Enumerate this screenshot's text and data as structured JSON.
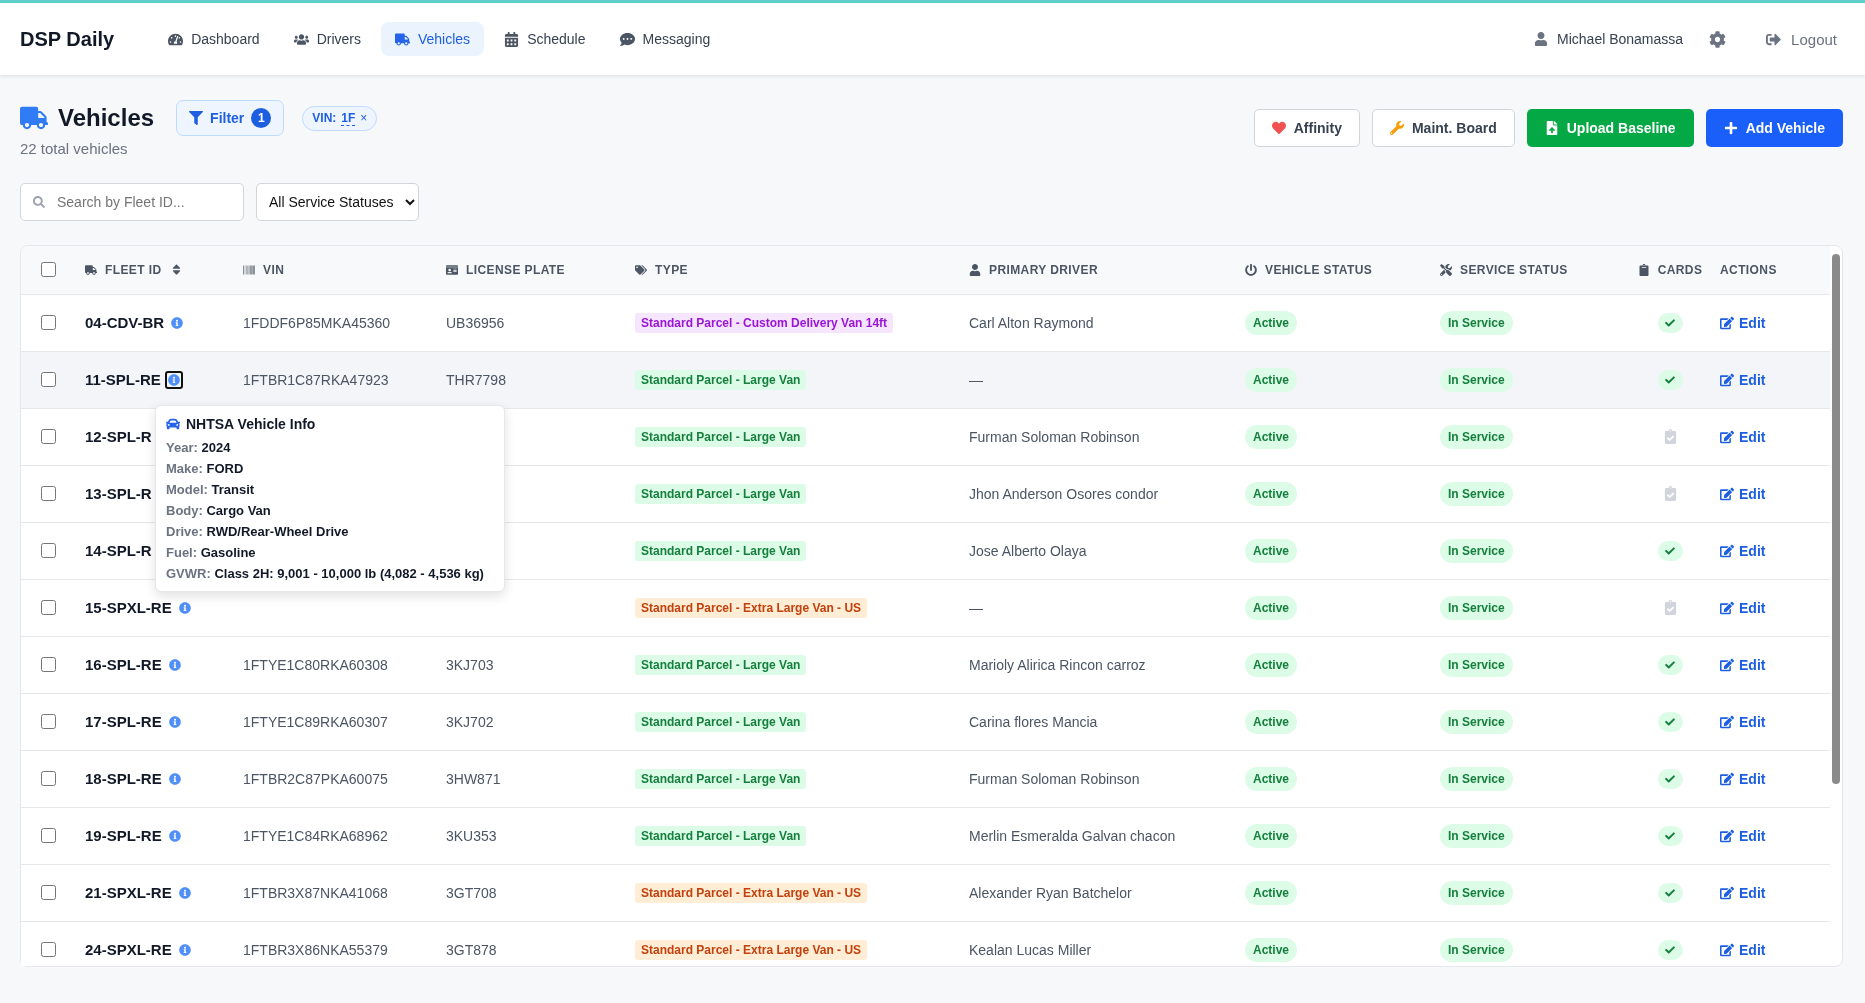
{
  "brand": "DSP Daily",
  "nav": [
    {
      "label": "Dashboard",
      "selected": false
    },
    {
      "label": "Drivers",
      "selected": false
    },
    {
      "label": "Vehicles",
      "selected": true
    },
    {
      "label": "Schedule",
      "selected": false
    },
    {
      "label": "Messaging",
      "selected": false
    }
  ],
  "user": {
    "name": "Michael Bonamassa"
  },
  "logout": "Logout",
  "page": {
    "title": "Vehicles",
    "subtitle": "22 total vehicles"
  },
  "filter_button": {
    "label": "Filter",
    "count": "1"
  },
  "filter_chips": [
    {
      "label": "VIN:",
      "value": "1F",
      "remove": "×"
    }
  ],
  "actions": [
    {
      "label": "Affinity",
      "kind": "outline"
    },
    {
      "label": "Maint. Board",
      "kind": "outline"
    },
    {
      "label": "Upload Baseline",
      "kind": "success"
    },
    {
      "label": "Add Vehicle",
      "kind": "primary"
    }
  ],
  "search": {
    "placeholder": "Search by Fleet ID..."
  },
  "status_select": {
    "value": "All Service Statuses"
  },
  "table": {
    "select_all": {
      "checked": false
    },
    "columns": [
      {
        "label": "FLEET ID",
        "sortable": true
      },
      {
        "label": "VIN",
        "sortable": false
      },
      {
        "label": "LICENSE PLATE",
        "sortable": false
      },
      {
        "label": "TYPE",
        "sortable": false
      },
      {
        "label": "PRIMARY DRIVER",
        "sortable": false
      },
      {
        "label": "VEHICLE STATUS",
        "sortable": false
      },
      {
        "label": "SERVICE STATUS",
        "sortable": false
      },
      {
        "label": "CARDS",
        "sortable": false
      },
      {
        "label": "ACTIONS",
        "sortable": false
      }
    ],
    "rows": [
      {
        "fleet_id": "04-CDV-BR",
        "vin": "1FDDF6P85MKA45360",
        "plate": "UB36956",
        "type": {
          "label": "Standard Parcel - Custom Delivery Van 14ft",
          "kind": "custom"
        },
        "driver": "Carl Alton Raymond",
        "vehicle_status": "Active",
        "service_status": "In Service",
        "cards_complete": true,
        "action": "Edit",
        "checked": false,
        "hovered": false
      },
      {
        "fleet_id": "11-SPL-RE",
        "vin": "1FTBR1C87RKA47923",
        "plate": "THR7798",
        "type": {
          "label": "Standard Parcel - Large Van",
          "kind": "large"
        },
        "driver": "—",
        "vehicle_status": "Active",
        "service_status": "In Service",
        "cards_complete": true,
        "action": "Edit",
        "checked": false,
        "hovered": true,
        "tooltip": {
          "title": "NHTSA Vehicle Info",
          "fields": [
            {
              "label": "Year:",
              "value": "2024"
            },
            {
              "label": "Make:",
              "value": "FORD"
            },
            {
              "label": "Model:",
              "value": "Transit"
            },
            {
              "label": "Body:",
              "value": "Cargo Van"
            },
            {
              "label": "Drive:",
              "value": "RWD/Rear-Wheel Drive"
            },
            {
              "label": "Fuel:",
              "value": "Gasoline"
            },
            {
              "label": "GVWR:",
              "value": "Class 2H: 9,001 - 10,000 lb (4,082 - 4,536 kg)"
            }
          ]
        }
      },
      {
        "fleet_id": "12-SPL-R",
        "type": {
          "label": "Standard Parcel - Large Van",
          "kind": "large"
        },
        "driver": "Furman Soloman Robinson",
        "vehicle_status": "Active",
        "service_status": "In Service",
        "cards_complete": false,
        "action": "Edit",
        "checked": false,
        "hovered": false
      },
      {
        "fleet_id": "13-SPL-R",
        "type": {
          "label": "Standard Parcel - Large Van",
          "kind": "large"
        },
        "driver": "Jhon Anderson Osores condor",
        "vehicle_status": "Active",
        "service_status": "In Service",
        "cards_complete": false,
        "action": "Edit",
        "checked": false,
        "hovered": false
      },
      {
        "fleet_id": "14-SPL-R",
        "type": {
          "label": "Standard Parcel - Large Van",
          "kind": "large"
        },
        "driver": "Jose Alberto Olaya",
        "vehicle_status": "Active",
        "service_status": "In Service",
        "cards_complete": true,
        "action": "Edit",
        "checked": false,
        "hovered": false
      },
      {
        "fleet_id": "15-SPXL-RE",
        "type": {
          "label": "Standard Parcel - Extra Large Van - US",
          "kind": "xl"
        },
        "driver": "—",
        "vehicle_status": "Active",
        "service_status": "In Service",
        "cards_complete": false,
        "action": "Edit",
        "checked": false,
        "hovered": false
      },
      {
        "fleet_id": "16-SPL-RE",
        "vin": "1FTYE1C80RKA60308",
        "plate": "3KJ703",
        "type": {
          "label": "Standard Parcel - Large Van",
          "kind": "large"
        },
        "driver": "Marioly Alirica Rincon carroz",
        "vehicle_status": "Active",
        "service_status": "In Service",
        "cards_complete": true,
        "action": "Edit",
        "checked": false,
        "hovered": false
      },
      {
        "fleet_id": "17-SPL-RE",
        "vin": "1FTYE1C89RKA60307",
        "plate": "3KJ702",
        "type": {
          "label": "Standard Parcel - Large Van",
          "kind": "large"
        },
        "driver": "Carina flores Mancia",
        "vehicle_status": "Active",
        "service_status": "In Service",
        "cards_complete": true,
        "action": "Edit",
        "checked": false,
        "hovered": false
      },
      {
        "fleet_id": "18-SPL-RE",
        "vin": "1FTBR2C87PKA60075",
        "plate": "3HW871",
        "type": {
          "label": "Standard Parcel - Large Van",
          "kind": "large"
        },
        "driver": "Furman Soloman Robinson",
        "vehicle_status": "Active",
        "service_status": "In Service",
        "cards_complete": true,
        "action": "Edit",
        "checked": false,
        "hovered": false
      },
      {
        "fleet_id": "19-SPL-RE",
        "vin": "1FTYE1C84RKA68962",
        "plate": "3KU353",
        "type": {
          "label": "Standard Parcel - Large Van",
          "kind": "large"
        },
        "driver": "Merlin Esmeralda Galvan chacon",
        "vehicle_status": "Active",
        "service_status": "In Service",
        "cards_complete": true,
        "action": "Edit",
        "checked": false,
        "hovered": false
      },
      {
        "fleet_id": "21-SPXL-RE",
        "vin": "1FTBR3X87NKA41068",
        "plate": "3GT708",
        "type": {
          "label": "Standard Parcel - Extra Large Van - US",
          "kind": "xl"
        },
        "driver": "Alexander Ryan Batchelor",
        "vehicle_status": "Active",
        "service_status": "In Service",
        "cards_complete": true,
        "action": "Edit",
        "checked": false,
        "hovered": false
      },
      {
        "fleet_id": "24-SPXL-RE",
        "vin": "1FTBR3X86NKA55379",
        "plate": "3GT878",
        "type": {
          "label": "Standard Parcel - Extra Large Van - US",
          "kind": "xl"
        },
        "driver": "Kealan Lucas Miller",
        "vehicle_status": "Active",
        "service_status": "In Service",
        "cards_complete": true,
        "action": "Edit",
        "checked": false,
        "hovered": false
      }
    ]
  }
}
